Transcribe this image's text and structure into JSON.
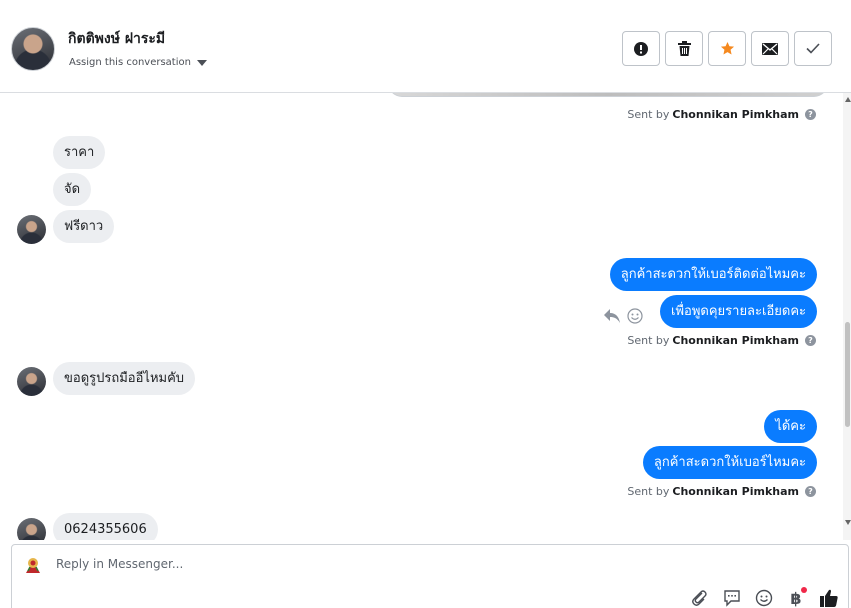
{
  "header": {
    "contact_name": "กิตติพงษ์ ฝาระมี",
    "assign_label": "Assign this conversation",
    "actions": [
      {
        "name": "spam",
        "icon": "alert-icon"
      },
      {
        "name": "delete",
        "icon": "trash-icon"
      },
      {
        "name": "star",
        "icon": "star-icon",
        "color": "#f5891f"
      },
      {
        "name": "unread",
        "icon": "envelope-icon"
      },
      {
        "name": "done",
        "icon": "check-icon"
      }
    ]
  },
  "sent_by": {
    "prefix": "Sent by",
    "name": "Chonnikan Pimkham",
    "help": "?"
  },
  "messages": [
    {
      "dir": "in",
      "text": "ราคา"
    },
    {
      "dir": "in",
      "text": "จัด"
    },
    {
      "dir": "in",
      "text": "ฟรีดาว"
    },
    {
      "dir": "out",
      "text": "ลูกค้าสะดวกให้เบอร์ติดต่อไหมคะ"
    },
    {
      "dir": "out",
      "text": "เพื่อพูดคุยรายละเอียดคะ"
    },
    {
      "dir": "in",
      "text": "ขอดูรูปรถมืออีไหมคับ"
    },
    {
      "dir": "out",
      "text": "ได้คะ"
    },
    {
      "dir": "out",
      "text": "ลูกค้าสะดวกให้เบอร์ไหมคะ"
    },
    {
      "dir": "in",
      "text": "0624355606"
    }
  ],
  "composer": {
    "placeholder": "Reply in Messenger...",
    "tools": [
      "paperclip-icon",
      "saved-reply-icon",
      "emoji-icon",
      "baht-icon",
      "like-icon"
    ],
    "baht_symbol": "฿"
  },
  "colors": {
    "outgoing_bubble": "#0a7cff",
    "incoming_bubble": "#eceef1",
    "star": "#f5891f"
  }
}
